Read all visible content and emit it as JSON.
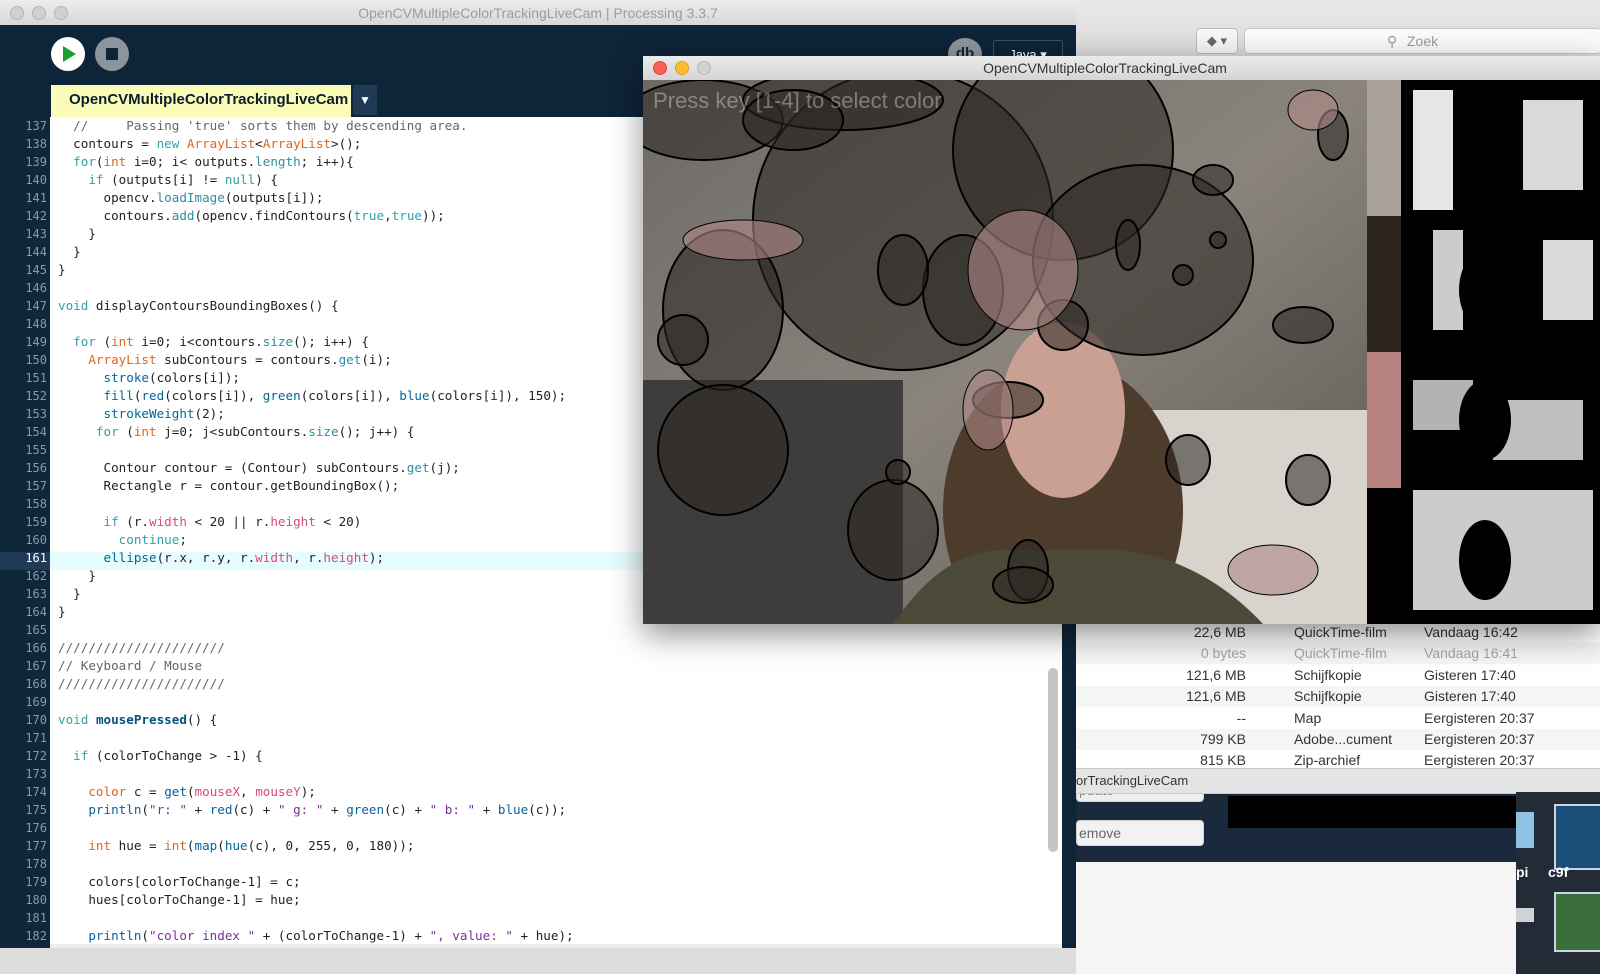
{
  "ide": {
    "title": "OpenCVMultipleColorTrackingLiveCam | Processing 3.3.7",
    "debug_label": "db",
    "mode_label": "Java ▾",
    "tab_label": "OpenCVMultipleColorTrackingLiveCam",
    "tab_menu": "▼",
    "current_line": "161",
    "lines": [
      {
        "n": "137",
        "html": "  <span class=\"c\">//     Passing 'true' sorts them by descending area.</span>"
      },
      {
        "n": "138",
        "html": "  contours = <span class=\"k\">new</span> <span class=\"t\">ArrayList</span>&lt;<span class=\"t\">ArrayList</span>&gt;();"
      },
      {
        "n": "139",
        "html": "  <span class=\"k\">for</span>(<span class=\"t\">int</span> i=0; i&lt; outputs.<span class=\"f2\">length</span>; i++){"
      },
      {
        "n": "140",
        "html": "    <span class=\"k\">if</span> (outputs[i] != <span class=\"k\">null</span>) {"
      },
      {
        "n": "141",
        "html": "      opencv.<span class=\"f2\">loadImage</span>(outputs[i]);"
      },
      {
        "n": "142",
        "html": "      contours.<span class=\"f2\">add</span>(opencv.findContours(<span class=\"k\">true</span>,<span class=\"k\">true</span>));"
      },
      {
        "n": "143",
        "html": "    }"
      },
      {
        "n": "144",
        "html": "  }"
      },
      {
        "n": "145",
        "html": "}"
      },
      {
        "n": "146",
        "html": ""
      },
      {
        "n": "147",
        "html": "<span class=\"k\">void</span> displayContoursBoundingBoxes() {"
      },
      {
        "n": "148",
        "html": ""
      },
      {
        "n": "149",
        "html": "  <span class=\"k\">for</span> (<span class=\"t\">int</span> i=0; i&lt;contours.<span class=\"f2\">size</span>(); i++) {"
      },
      {
        "n": "150",
        "html": "    <span class=\"t\">ArrayList</span> subContours = contours.<span class=\"f2\">get</span>(i);"
      },
      {
        "n": "151",
        "html": "      <span class=\"f\">stroke</span>(colors[i]);"
      },
      {
        "n": "152",
        "html": "      <span class=\"f\">fill</span>(<span class=\"f\">red</span>(colors[i]), <span class=\"f\">green</span>(colors[i]), <span class=\"f\">blue</span>(colors[i]), 150);"
      },
      {
        "n": "153",
        "html": "      <span class=\"f\">strokeWeight</span>(2);"
      },
      {
        "n": "154",
        "html": "     <span class=\"k\">for</span> (<span class=\"t\">int</span> j=0; j&lt;subContours.<span class=\"f2\">size</span>(); j++) {"
      },
      {
        "n": "155",
        "html": ""
      },
      {
        "n": "156",
        "html": "      Contour contour = (Contour) subContours.<span class=\"f2\">get</span>(j);"
      },
      {
        "n": "157",
        "html": "      Rectangle r = contour.getBoundingBox();"
      },
      {
        "n": "158",
        "html": ""
      },
      {
        "n": "159",
        "html": "      <span class=\"k\">if</span> (r.<span class=\"v\">width</span> &lt; 20 || r.<span class=\"v\">height</span> &lt; 20)"
      },
      {
        "n": "160",
        "html": "        <span class=\"k\">continue</span>;"
      },
      {
        "n": "161",
        "html": "      <span class=\"f\">ellipse</span>(r.x, r.y, r.<span class=\"v\">width</span>, r.<span class=\"v\">height</span>);"
      },
      {
        "n": "162",
        "html": "    }"
      },
      {
        "n": "163",
        "html": "  }"
      },
      {
        "n": "164",
        "html": "}"
      },
      {
        "n": "165",
        "html": ""
      },
      {
        "n": "166",
        "html": "<span class=\"c\">//////////////////////</span>"
      },
      {
        "n": "167",
        "html": "<span class=\"c\">// Keyboard / Mouse</span>"
      },
      {
        "n": "168",
        "html": "<span class=\"c\">//////////////////////</span>"
      },
      {
        "n": "169",
        "html": ""
      },
      {
        "n": "170",
        "html": "<span class=\"k\">void</span> <span class=\"b\">mousePressed</span>() {"
      },
      {
        "n": "171",
        "html": ""
      },
      {
        "n": "172",
        "html": "  <span class=\"k\">if</span> (colorToChange &gt; -1) {"
      },
      {
        "n": "173",
        "html": ""
      },
      {
        "n": "174",
        "html": "    <span class=\"t\">color</span> c = <span class=\"f\">get</span>(<span class=\"v\">mouseX</span>, <span class=\"v\">mouseY</span>);"
      },
      {
        "n": "175",
        "html": "    <span class=\"f\">println</span>(<span class=\"s\">\"r: \"</span> + <span class=\"f\">red</span>(c) + <span class=\"s\">\" g: \"</span> + <span class=\"f\">green</span>(c) + <span class=\"s\">\" b: \"</span> + <span class=\"f\">blue</span>(c));"
      },
      {
        "n": "176",
        "html": ""
      },
      {
        "n": "177",
        "html": "    <span class=\"t\">int</span> hue = <span class=\"t\">int</span>(<span class=\"f\">map</span>(<span class=\"f\">hue</span>(c), 0, 255, 0, 180));"
      },
      {
        "n": "178",
        "html": ""
      },
      {
        "n": "179",
        "html": "    colors[colorToChange-1] = c;"
      },
      {
        "n": "180",
        "html": "    hues[colorToChange-1] = hue;"
      },
      {
        "n": "181",
        "html": ""
      },
      {
        "n": "182",
        "html": "    <span class=\"f\">println</span>(<span class=\"s\">\"color index \"</span> + (colorToChange-1) + <span class=\"s\">\", value: \"</span> + hue);"
      }
    ]
  },
  "sketch": {
    "title": "OpenCVMultipleColorTrackingLiveCam",
    "overlay_text": "Press key [1-4] to select color"
  },
  "finder": {
    "search_placeholder": "Zoek",
    "search_icon": "magnifier-icon",
    "dropbox_label": "◆ ▾",
    "files": [
      {
        "size": "22,6 MB",
        "kind": "QuickTime-film",
        "date": "Vandaag 16:42",
        "dim": false
      },
      {
        "size": "0 bytes",
        "kind": "QuickTime-film",
        "date": "Vandaag 16:41",
        "dim": true
      },
      {
        "size": "121,6 MB",
        "kind": "Schijfkopie",
        "date": "Gisteren 17:40",
        "dim": false
      },
      {
        "size": "121,6 MB",
        "kind": "Schijfkopie",
        "date": "Gisteren 17:40",
        "dim": false
      },
      {
        "size": "--",
        "kind": "Map",
        "date": "Eergisteren 20:37",
        "dim": false
      },
      {
        "size": "799 KB",
        "kind": "Adobe...cument",
        "date": "Eergisteren 20:37",
        "dim": false
      },
      {
        "size": "815 KB",
        "kind": "Zip-archief",
        "date": "Eergisteren 20:37",
        "dim": false
      }
    ]
  },
  "background": {
    "strip_title": "orTrackingLiveCam",
    "update_label": "pdate",
    "remove_label": "emove",
    "pi_label": "pi",
    "c9_label": "c9f"
  },
  "colors": {
    "ide_bg": "#0e2438",
    "tab_active": "#fbfcb8",
    "run_green": "#1f9e33",
    "swatch_top": "#a9a39b",
    "swatch_dark": "#2a241a",
    "swatch_pink": "#b6827f"
  }
}
